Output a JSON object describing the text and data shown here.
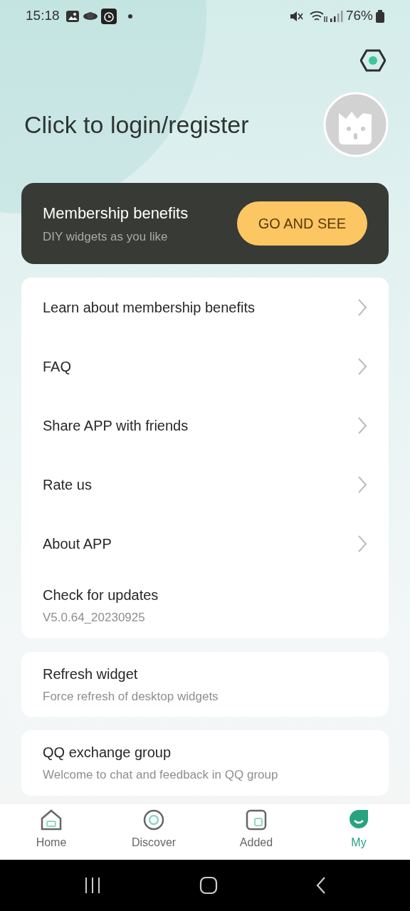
{
  "status_bar": {
    "time": "15:18",
    "battery": "76%"
  },
  "header": {
    "title": "Click to login/register"
  },
  "membership": {
    "title": "Membership benefits",
    "subtitle": "DIY widgets as you like",
    "button": "GO AND SEE"
  },
  "groups": [
    {
      "items": [
        {
          "kind": "link",
          "label": "Learn about membership benefits"
        },
        {
          "kind": "link",
          "label": "FAQ"
        },
        {
          "kind": "link",
          "label": "Share APP with friends"
        },
        {
          "kind": "link",
          "label": "Rate us"
        },
        {
          "kind": "link",
          "label": "About APP"
        },
        {
          "kind": "info",
          "label": "Check for updates",
          "subtitle": "V5.0.64_20230925"
        }
      ]
    },
    {
      "items": [
        {
          "kind": "info",
          "label": "Refresh widget",
          "subtitle": "Force refresh of desktop widgets"
        }
      ]
    },
    {
      "items": [
        {
          "kind": "info",
          "label": "QQ exchange group",
          "subtitle": "Welcome to chat and feedback in QQ group"
        }
      ]
    }
  ],
  "tabs": [
    {
      "label": "Home",
      "kind": "home",
      "selected": false
    },
    {
      "label": "Discover",
      "kind": "discover",
      "selected": false
    },
    {
      "label": "Added",
      "kind": "added",
      "selected": false
    },
    {
      "label": "My",
      "kind": "my",
      "selected": true
    }
  ]
}
